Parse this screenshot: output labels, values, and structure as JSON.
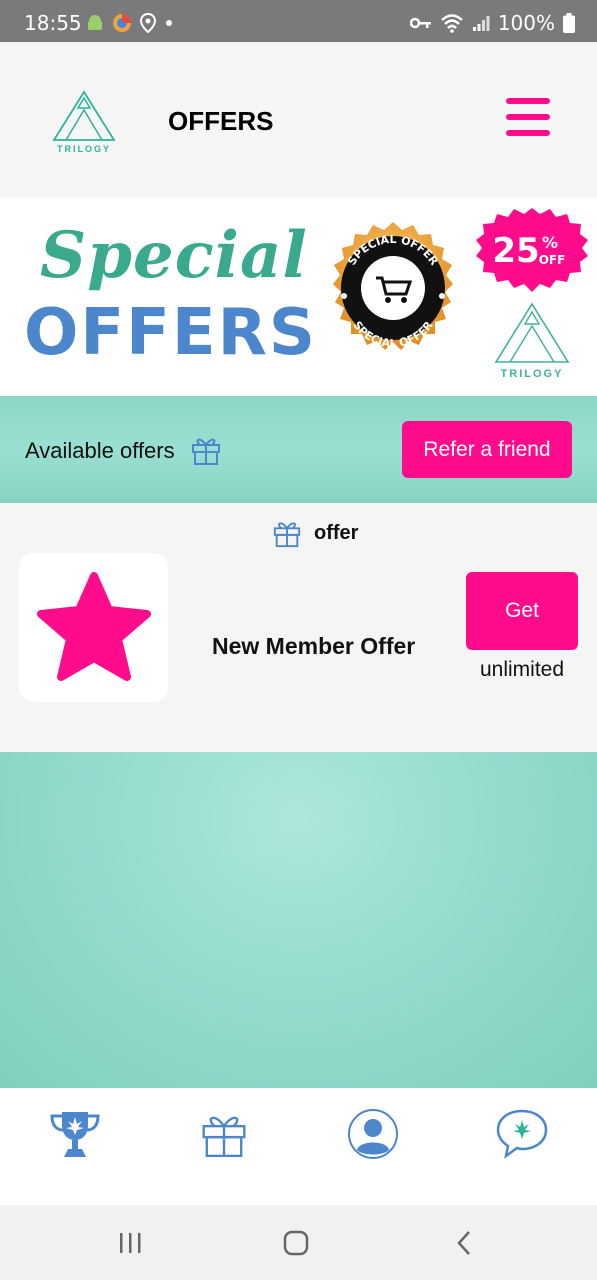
{
  "status_bar": {
    "time": "18:55",
    "battery": "100%"
  },
  "header": {
    "logo_text": "TRILOGY",
    "title": "OFFERS"
  },
  "banner": {
    "line1": "Special",
    "line2": "OFFERS",
    "seal_top": "SPECIAL OFFER",
    "seal_bottom": "SPECIAL OFFER",
    "discount_value": "25",
    "discount_percent": "%",
    "discount_off": "OFF",
    "logo_text": "TRILOGY"
  },
  "offers_strip": {
    "label": "Available offers",
    "refer_button": "Refer a friend"
  },
  "offers_section": {
    "heading": "offer",
    "items": [
      {
        "name": "New Member Offer",
        "button": "Get",
        "limit": "unlimited"
      }
    ]
  },
  "colors": {
    "accent_pink": "#ff0c8c",
    "teal": "#8ad7c8",
    "icon_blue": "#4c86cc"
  },
  "tabs": [
    {
      "icon": "trophy-icon"
    },
    {
      "icon": "gift-icon"
    },
    {
      "icon": "profile-icon"
    },
    {
      "icon": "chat-icon"
    }
  ]
}
